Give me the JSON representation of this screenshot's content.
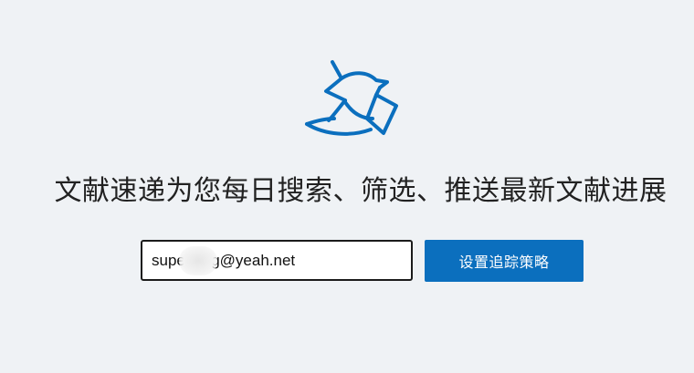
{
  "logo": {
    "icon": "bird-with-paper-icon",
    "color": "#0b6fbe"
  },
  "headline": "文献速递为您每日搜索、筛选、推送最新文献进展",
  "email": {
    "value": "supe      g@yeah.net",
    "placeholder": ""
  },
  "submit_label": "设置追踪策略",
  "colors": {
    "accent": "#0b6fbe",
    "background": "#eff2f5"
  }
}
